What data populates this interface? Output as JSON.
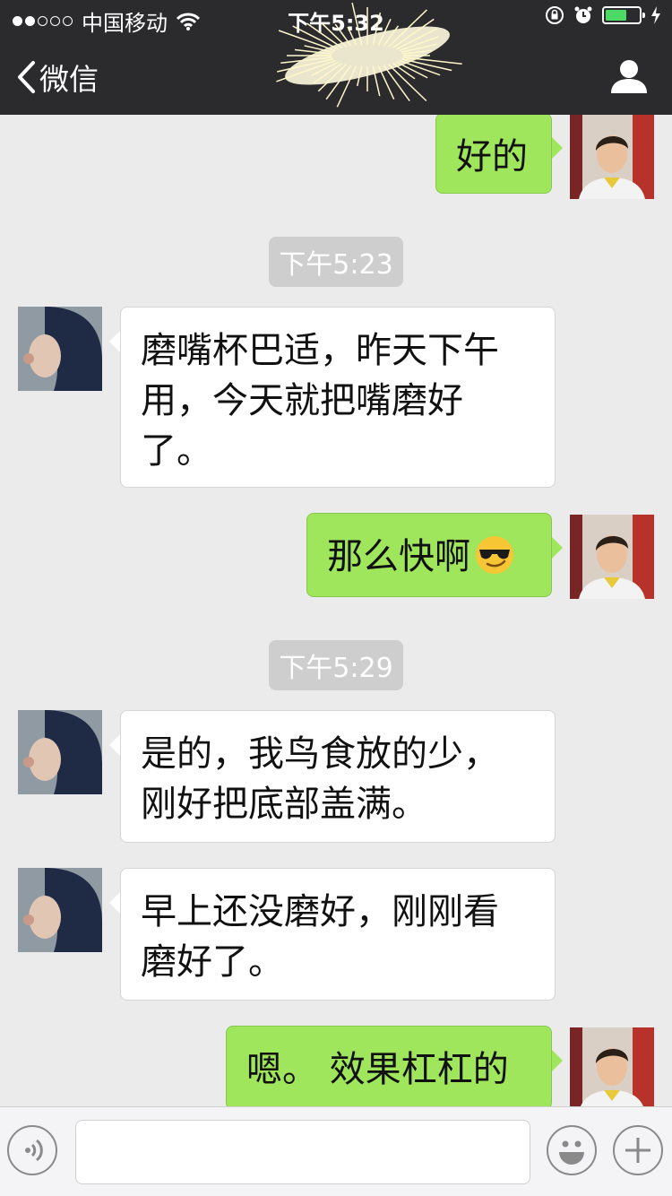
{
  "status_bar": {
    "carrier": "中国移动",
    "time": "下午5:32",
    "signal_dots_filled": 2,
    "signal_dots_total": 5,
    "battery_level": 0.65
  },
  "nav": {
    "back_label": "微信"
  },
  "messages": [
    {
      "type": "message",
      "side": "me",
      "text": "好的"
    },
    {
      "type": "timestamp",
      "text": "下午5:23"
    },
    {
      "type": "message",
      "side": "them",
      "lines": [
        "磨嘴杯巴适，昨天下午",
        "用，今天就把嘴磨好",
        "了。"
      ]
    },
    {
      "type": "message",
      "side": "me",
      "text": "那么快啊",
      "emoji": "sunglasses-emoji"
    },
    {
      "type": "timestamp",
      "text": "下午5:29"
    },
    {
      "type": "message",
      "side": "them",
      "lines": [
        "是的，我鸟食放的少，",
        "刚好把底部盖满。"
      ]
    },
    {
      "type": "message",
      "side": "them",
      "lines": [
        "早上还没磨好，刚刚看",
        "磨好了。"
      ]
    },
    {
      "type": "message",
      "side": "me",
      "text": "嗯。 效果杠杠的"
    }
  ],
  "input_bar": {
    "voice_icon": "voice-icon",
    "emoji_icon": "emoji-icon",
    "plus_icon": "plus-icon",
    "text_value": ""
  },
  "colors": {
    "bar_bg": "#2b2b2d",
    "chat_bg": "#ebebeb",
    "my_bubble": "#9fe65c",
    "their_bubble": "#ffffff",
    "timestamp_bg": "#cecece"
  }
}
